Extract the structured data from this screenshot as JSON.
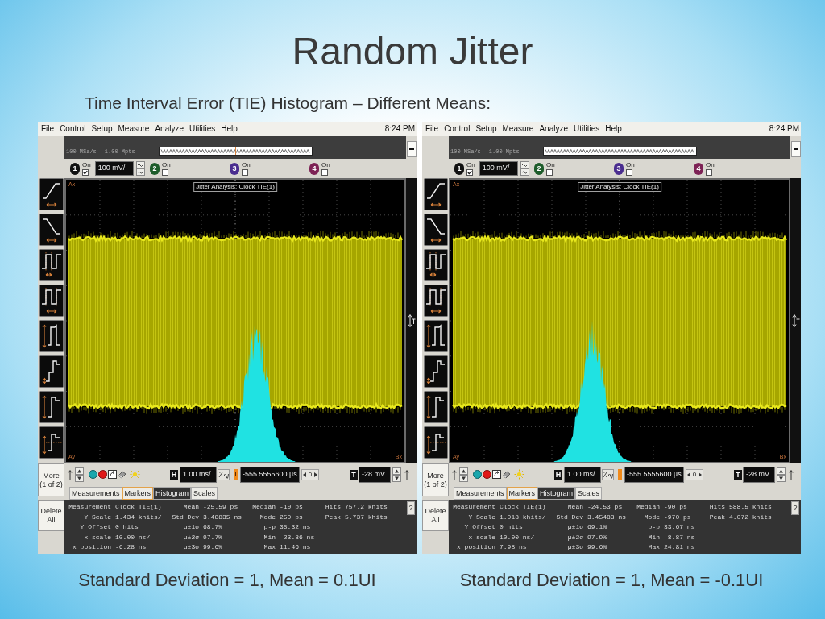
{
  "slide": {
    "title": "Random Jitter",
    "subtitle": "Time Interval Error (TIE) Histogram – Different Means:"
  },
  "screenshots": [
    {
      "menu": [
        "File",
        "Control",
        "Setup",
        "Measure",
        "Analyze",
        "Utilities",
        "Help"
      ],
      "clock": "8:24 PM",
      "acquisition": {
        "sample_rate": "100 MSa/s",
        "memory_depth": "1.00 Mpts"
      },
      "channels": [
        {
          "number": "1",
          "label": "On",
          "checked": true,
          "color": "#111111",
          "scale": "100 mV/"
        },
        {
          "number": "2",
          "label": "On",
          "checked": false,
          "color": "#1d5c2a"
        },
        {
          "number": "3",
          "label": "On",
          "checked": false,
          "color": "#4a2d8f"
        },
        {
          "number": "4",
          "label": "On",
          "checked": false,
          "color": "#7d2255"
        }
      ],
      "display": {
        "title": "Jitter Analysis: Clock TIE(1)",
        "top_left_label": "Ax",
        "bottom_left_label": "Ay",
        "bottom_right_label": "Bx"
      },
      "more_button": {
        "label": "More",
        "page": "(1 of 2)"
      },
      "toolbar": {
        "horizontal_label": "H",
        "time_scale": "1.00 ms/",
        "delay": "-555.5555600 µs",
        "reference": "0",
        "trigger_label": "T",
        "trigger_level": "-28 mV"
      },
      "tabs": [
        {
          "label": "Measurements",
          "selected": false,
          "highlighted": false
        },
        {
          "label": "Markers",
          "selected": false,
          "highlighted": true
        },
        {
          "label": "Histogram",
          "selected": true,
          "highlighted": false
        },
        {
          "label": "Scales",
          "selected": false,
          "highlighted": false
        }
      ],
      "delete_button": "Delete All",
      "measurements": [
        [
          {
            "label": "Measurement",
            "value": "Clock TIE(1)"
          },
          {
            "label": "Mean",
            "value": "-25.59 ps"
          },
          {
            "label": "Median",
            "value": "-10 ps"
          },
          {
            "label": "Hits",
            "value": "757.2 khits"
          }
        ],
        [
          {
            "label": "Y Scale",
            "value": "1.434 khits/"
          },
          {
            "label": "Std Dev",
            "value": "3.48835 ns"
          },
          {
            "label": "Mode",
            "value": "250 ps"
          },
          {
            "label": "Peak",
            "value": "5.737 khits"
          }
        ],
        [
          {
            "label": "Y Offset",
            "value": "0 hits"
          },
          {
            "label": "µ±1σ",
            "value": "68.7%"
          },
          {
            "label": "p-p",
            "value": "35.32 ns"
          }
        ],
        [
          {
            "label": "x scale",
            "value": "10.00 ns/"
          },
          {
            "label": "µ±2σ",
            "value": "97.7%"
          },
          {
            "label": "Min",
            "value": "-23.86 ns"
          }
        ],
        [
          {
            "label": "x position",
            "value": "-6.28 ns"
          },
          {
            "label": "µ±3σ",
            "value": "99.6%"
          },
          {
            "label": "Max",
            "value": "11.46 ns"
          }
        ]
      ],
      "help_button": "?",
      "caption": "Standard Deviation = 1, Mean = 0.1UI"
    },
    {
      "menu": [
        "File",
        "Control",
        "Setup",
        "Measure",
        "Analyze",
        "Utilities",
        "Help"
      ],
      "clock": "8:24 PM",
      "acquisition": {
        "sample_rate": "100 MSa/s",
        "memory_depth": "1.00 Mpts"
      },
      "channels": [
        {
          "number": "1",
          "label": "On",
          "checked": true,
          "color": "#111111",
          "scale": "100 mV/"
        },
        {
          "number": "2",
          "label": "On",
          "checked": false,
          "color": "#1d5c2a"
        },
        {
          "number": "3",
          "label": "On",
          "checked": false,
          "color": "#4a2d8f"
        },
        {
          "number": "4",
          "label": "On",
          "checked": false,
          "color": "#7d2255"
        }
      ],
      "display": {
        "title": "Jitter Analysis: Clock TIE(1)",
        "top_left_label": "Ax",
        "bottom_left_label": "Ay",
        "bottom_right_label": "Bx"
      },
      "more_button": {
        "label": "More",
        "page": "(1 of 2)"
      },
      "toolbar": {
        "horizontal_label": "H",
        "time_scale": "1.00 ms/",
        "delay": "-555.5555600 µs",
        "reference": "0",
        "trigger_label": "T",
        "trigger_level": "-28 mV"
      },
      "tabs": [
        {
          "label": "Measurements",
          "selected": false,
          "highlighted": false
        },
        {
          "label": "Markers",
          "selected": false,
          "highlighted": true
        },
        {
          "label": "Histogram",
          "selected": true,
          "highlighted": false
        },
        {
          "label": "Scales",
          "selected": false,
          "highlighted": false
        }
      ],
      "delete_button": "Delete All",
      "measurements": [
        [
          {
            "label": "Measurement",
            "value": "Clock TIE(1)"
          },
          {
            "label": "Mean",
            "value": "-24.53 ps"
          },
          {
            "label": "Median",
            "value": "-90 ps"
          },
          {
            "label": "Hits",
            "value": "588.5 khits"
          }
        ],
        [
          {
            "label": "Y Scale",
            "value": "1.018 khits/"
          },
          {
            "label": "Std Dev",
            "value": "3.45483 ns"
          },
          {
            "label": "Mode",
            "value": "-970 ps"
          },
          {
            "label": "Peak",
            "value": "4.072 khits"
          }
        ],
        [
          {
            "label": "Y Offset",
            "value": "0 hits"
          },
          {
            "label": "µ±1σ",
            "value": "69.1%"
          },
          {
            "label": "p-p",
            "value": "33.67 ns"
          }
        ],
        [
          {
            "label": "x scale",
            "value": "10.00 ns/"
          },
          {
            "label": "µ±2σ",
            "value": "97.9%"
          },
          {
            "label": "Min",
            "value": "-8.87 ns"
          }
        ],
        [
          {
            "label": "x position",
            "value": "7.98 ns"
          },
          {
            "label": "µ±3σ",
            "value": "99.6%"
          },
          {
            "label": "Max",
            "value": "24.81 ns"
          }
        ]
      ],
      "help_button": "?",
      "caption": "Standard Deviation = 1, Mean = -0.1UI"
    }
  ]
}
